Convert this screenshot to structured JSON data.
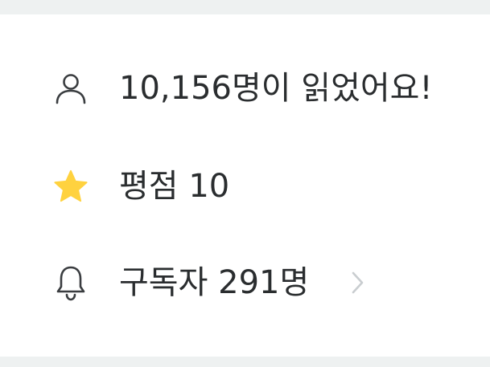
{
  "stats": {
    "readers": {
      "text": "10,156명이 읽었어요!",
      "icon": "person-icon"
    },
    "rating": {
      "text": "평점 10",
      "icon": "star-icon",
      "icon_color": "#FFD23F"
    },
    "subscribers": {
      "text": "구독자 291명",
      "icon": "bell-icon",
      "chevron": "chevron-right-icon"
    }
  },
  "colors": {
    "text": "#2a2d2f",
    "icon_stroke": "#3a3d40",
    "chevron": "#c9cdd0",
    "strip": "#eef1f1"
  }
}
